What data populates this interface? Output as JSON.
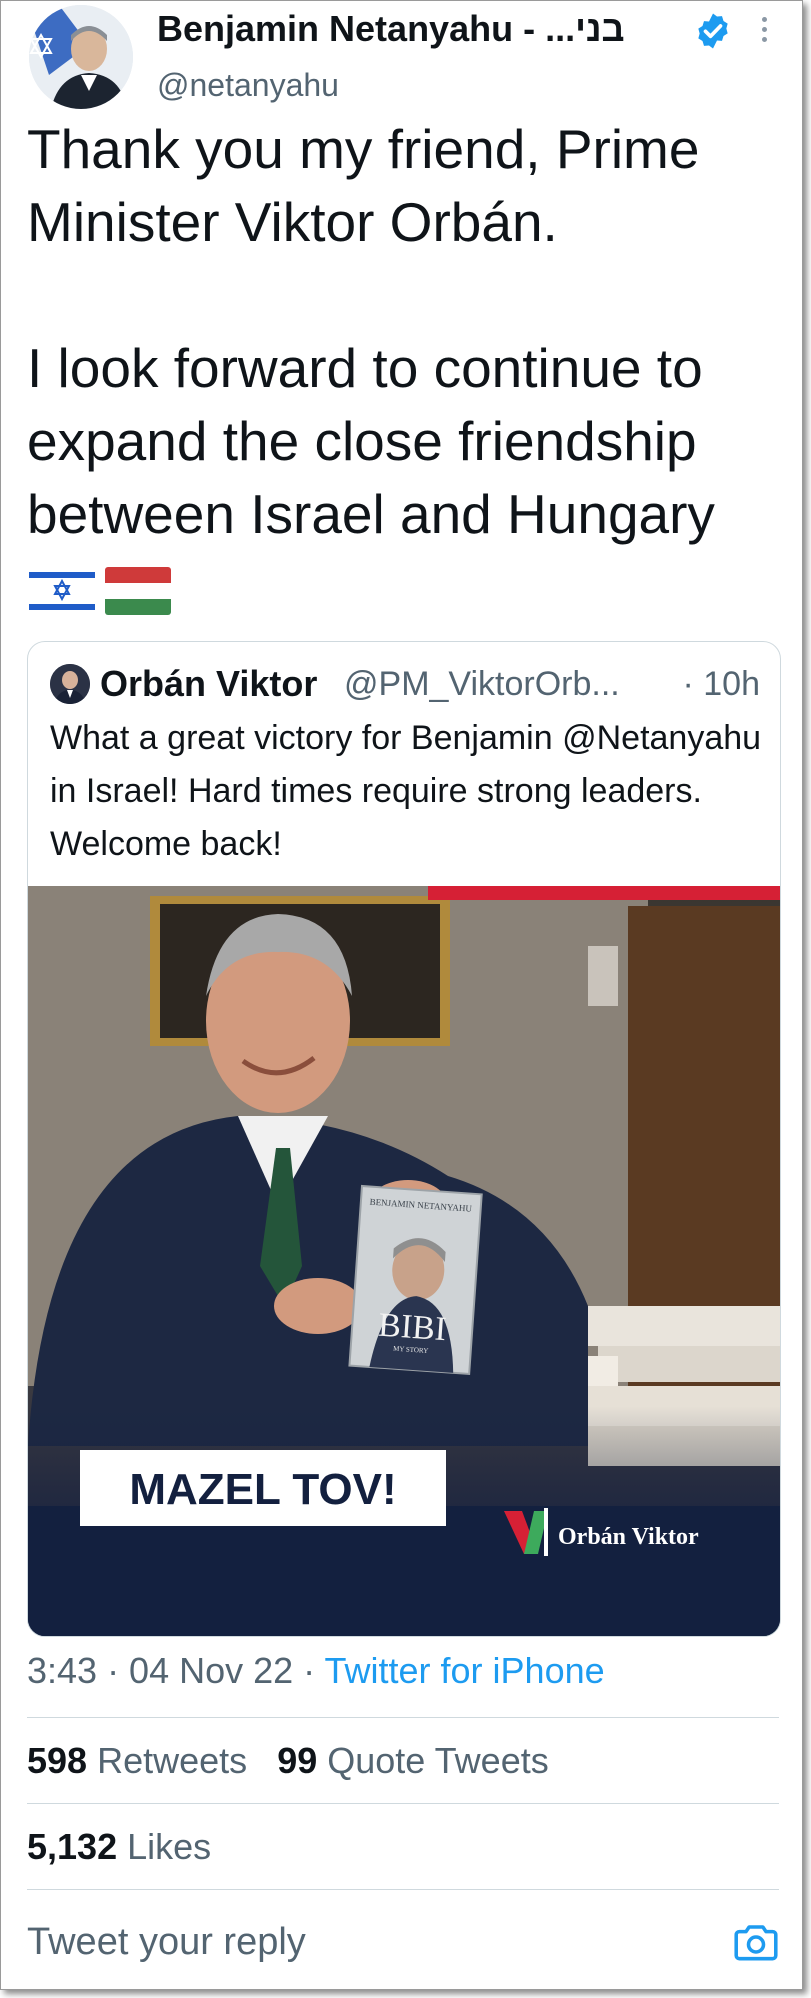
{
  "tweet": {
    "author_name": "Benjamin Netanyahu - ...בני",
    "handle": "@netanyahu",
    "text": "Thank you my friend, Prime Minister Viktor Orbán.\n\nI look forward to continue to expand the close friendship between Israel and Hungary",
    "flag_icons": [
      "israel-flag-icon",
      "hungary-flag-icon"
    ],
    "timestamp": "3:43 · 04 Nov 22 · ",
    "source": "Twitter for iPhone"
  },
  "quoted": {
    "author_name": "Orbán Viktor",
    "handle": "@PM_ViktorOrb...",
    "time": "· 10h",
    "text": "What a great victory for Benjamin @Netanyahu in Israel! Hard times require strong leaders. Welcome back!",
    "image": {
      "caption": "MAZEL TOV!",
      "book_author": "BENJAMIN NETANYAHU",
      "book_title": "BIBI",
      "book_subtitle": "MY STORY",
      "brand": "Orbán Viktor"
    }
  },
  "stats": {
    "retweets_count": "598",
    "retweets_label": "Retweets",
    "quotes_count": "99",
    "quotes_label": "Quote Tweets",
    "likes_count": "5,132",
    "likes_label": "Likes"
  },
  "reply": {
    "placeholder": "Tweet your reply"
  },
  "colors": {
    "accent": "#1d9bf0",
    "secondary_text": "#536471",
    "primary_text": "#0f1419",
    "border": "#cfd9de"
  }
}
